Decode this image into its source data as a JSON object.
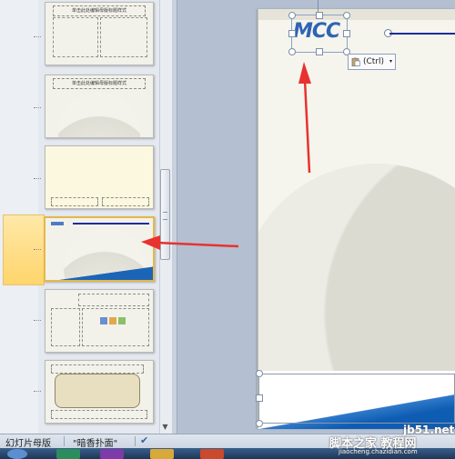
{
  "thumbnails": [
    {
      "title": "单击此处编辑母版标题样式"
    },
    {
      "title": "单击此处编辑母版标题样式"
    },
    {
      "title": ""
    },
    {
      "title": ""
    },
    {
      "title": ""
    },
    {
      "title": ""
    }
  ],
  "slide": {
    "logo_text": "MCC"
  },
  "paste_options": {
    "label": "(Ctrl)",
    "caret": "▾"
  },
  "statusbar": {
    "view": "幻灯片母版",
    "theme": "\"暗香扑面\"",
    "check_icon": "spell-check-icon"
  },
  "scrollbar": {
    "down_arrow": "▼"
  },
  "watermark": {
    "site": "jb51.net",
    "name": "脚本之家 教程网",
    "url": "jiaocheng.chazidian.com"
  },
  "colors": {
    "accent_blue": "#1c65b6",
    "arrow_red": "#e8322f",
    "selected_border": "#e4b84a"
  }
}
